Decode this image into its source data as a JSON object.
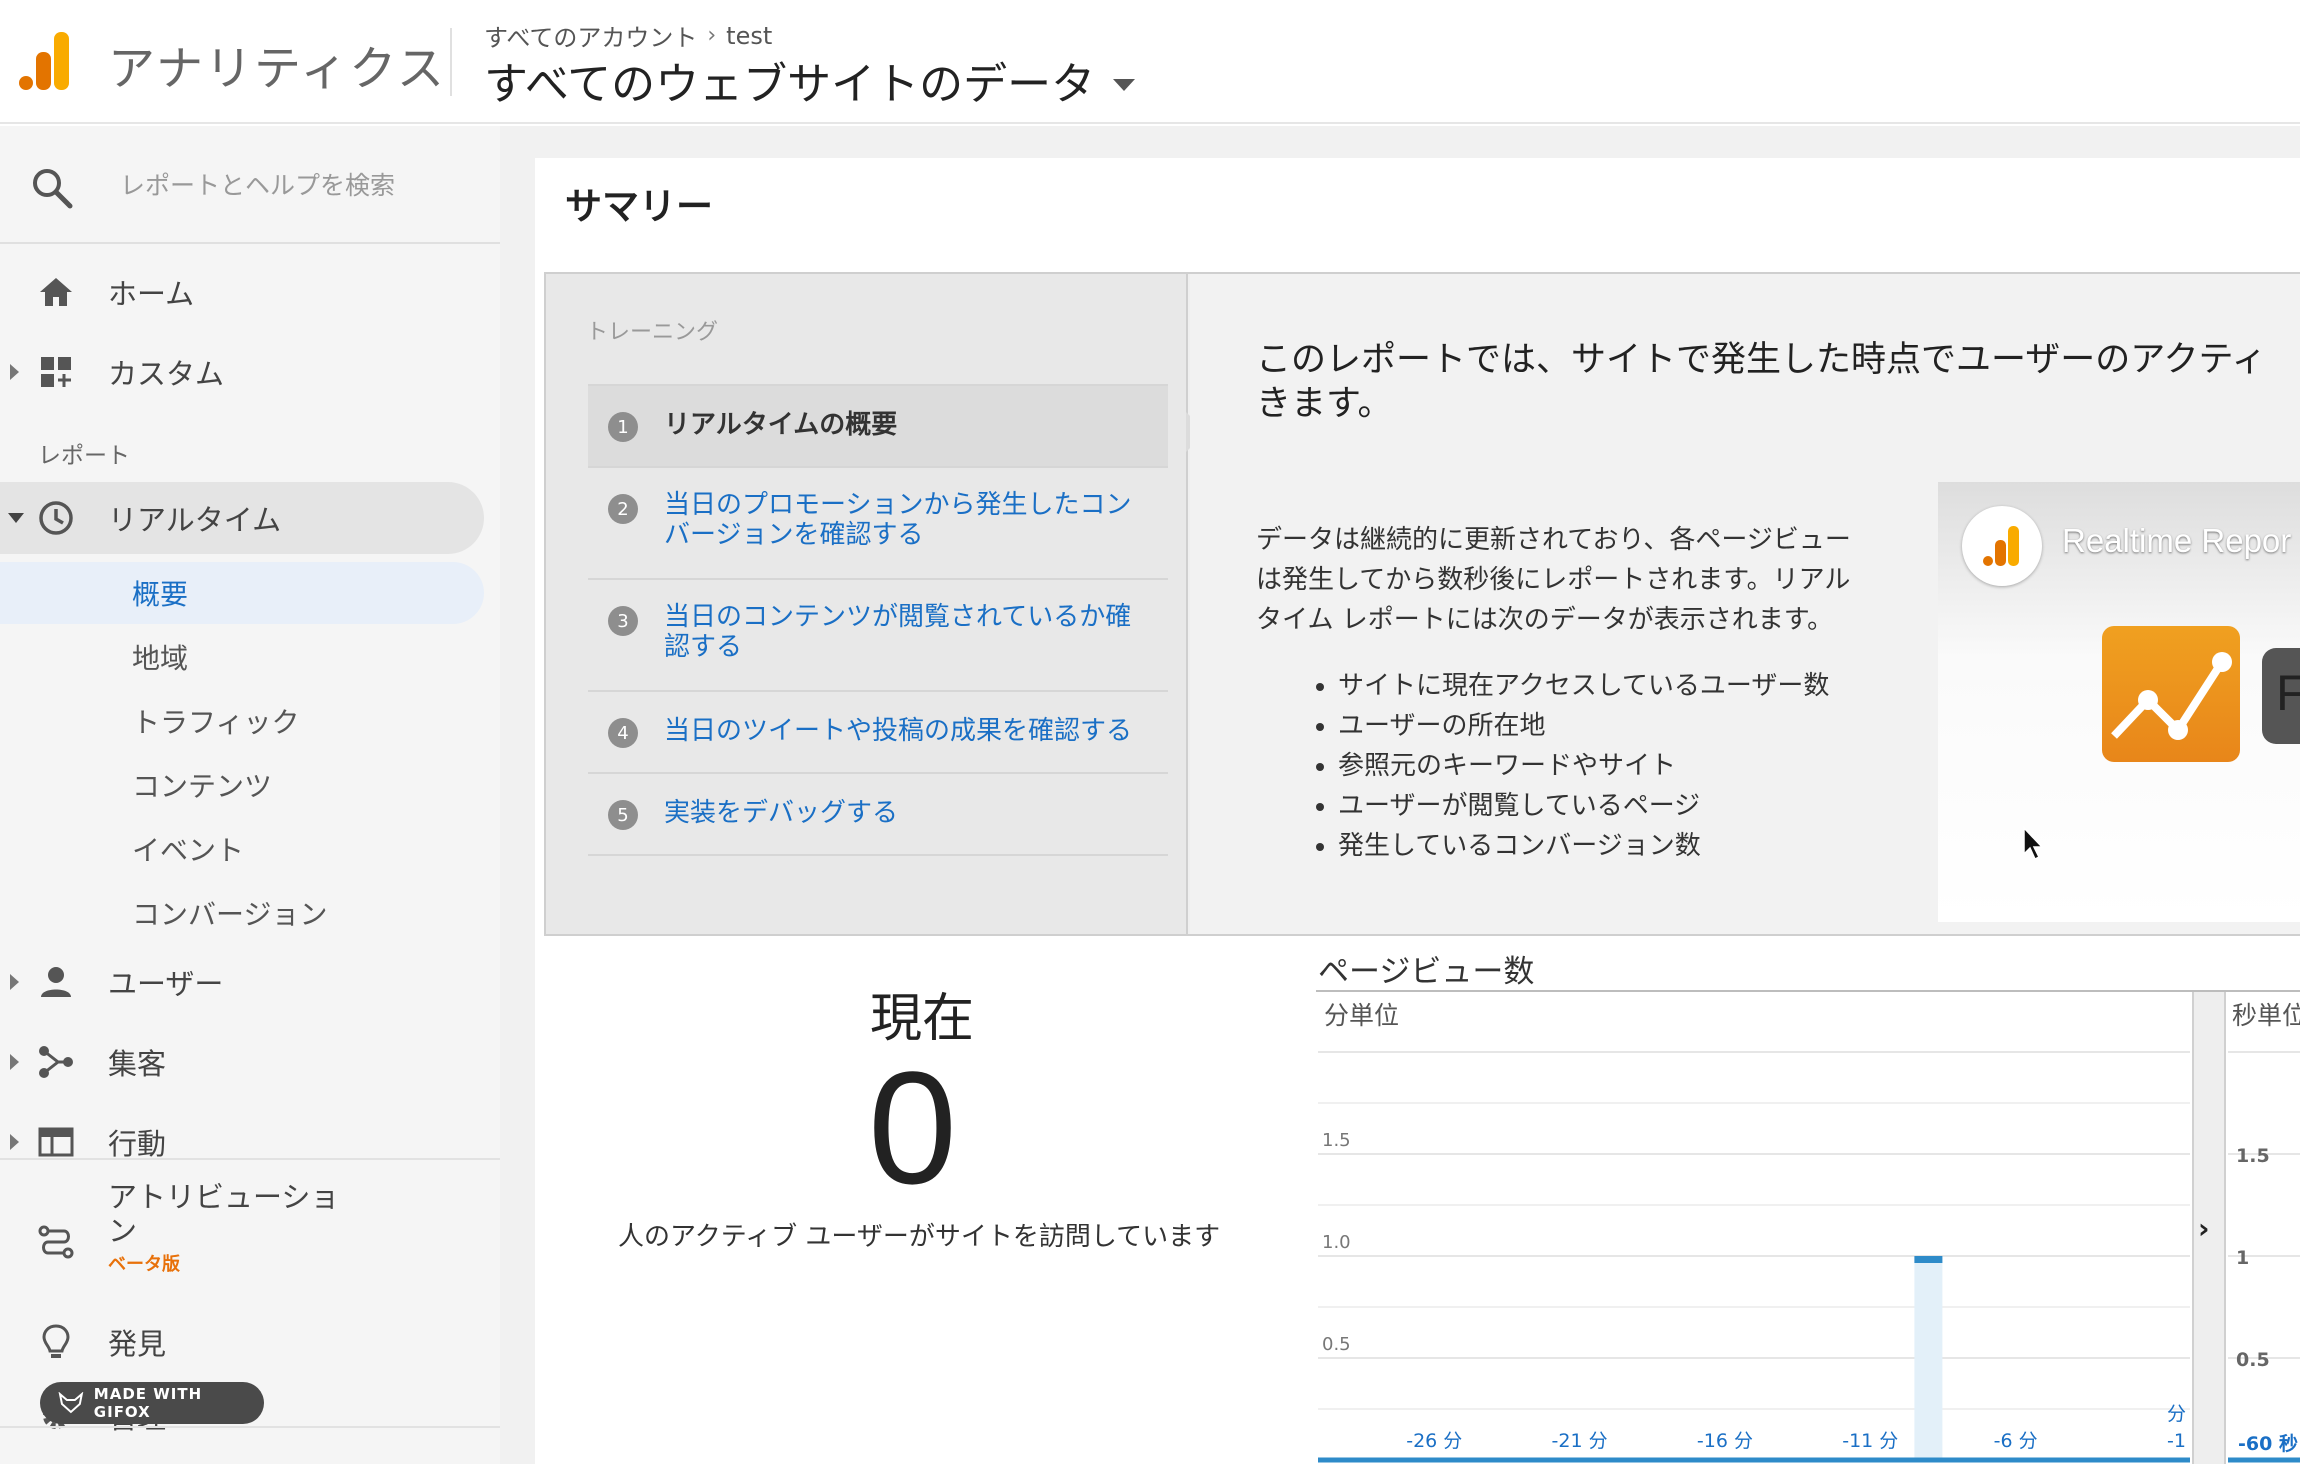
{
  "header": {
    "app_title": "アナリティクス",
    "breadcrumb": {
      "account": "すべてのアカウント",
      "property": "test"
    },
    "view_title": "すべてのウェブサイトのデータ"
  },
  "colors": {
    "accent_blue": "#1a6fc5",
    "logo_orange_light": "#f9ab00",
    "logo_orange_dark": "#e37400",
    "beta_orange": "#e8710a"
  },
  "sidebar": {
    "search_placeholder": "レポートとヘルプを検索",
    "home": "ホーム",
    "custom": "カスタム",
    "reports_label": "レポート",
    "realtime": "リアルタイム",
    "realtime_items": [
      "概要",
      "地域",
      "トラフィック",
      "コンテンツ",
      "イベント",
      "コンバージョン"
    ],
    "users": "ユーザー",
    "acquisition": "集客",
    "behavior": "行動",
    "attribution": "アトリビューション",
    "attribution_beta": "ベータ版",
    "discover": "発見",
    "admin": "管理",
    "gifox_badge": "MADE WITH GIFOX"
  },
  "main": {
    "page_title": "サマリー",
    "training": {
      "heading": "トレーニング",
      "steps": [
        {
          "num": "1",
          "text": "リアルタイムの概要"
        },
        {
          "num": "2",
          "text": "当日のプロモーションから発生したコンバージョンを確認する"
        },
        {
          "num": "3",
          "text": "当日のコンテンツが閲覧されているか確認する"
        },
        {
          "num": "4",
          "text": "当日のツイートや投稿の成果を確認する"
        },
        {
          "num": "5",
          "text": "実装をデバッグする"
        }
      ],
      "lead": "このレポートでは、サイトで発生した時点でユーザーのアクティ きます。",
      "description": "データは継続的に更新されており、各ページビューは発生してから数秒後にレポートされます。リアルタイム レポートには次のデータが表示されます。",
      "bullets": [
        "サイトに現在アクセスしているユーザー数",
        "ユーザーの所在地",
        "参照元のキーワードやサイト",
        "ユーザーが閲覧しているページ",
        "発生しているコンバージョン数"
      ],
      "video_title": "Realtime Repor",
      "video_letter": "F"
    },
    "current": {
      "label": "現在",
      "value": "0",
      "caption": "人のアクティブ ユーザーがサイトを訪問しています"
    }
  },
  "chart_data": {
    "type": "bar",
    "title": "ページビュー数",
    "panels": [
      {
        "label": "分単位",
        "x_ticks": [
          "-26 分",
          "-21 分",
          "-16 分",
          "-11 分",
          "-6 分",
          "-1"
        ],
        "x_unit_label": "分",
        "y_ticks": [
          "0.5",
          "1.0",
          "1.5"
        ],
        "ylim": [
          0,
          2
        ],
        "bars": [
          {
            "x": -9,
            "value": 1
          }
        ]
      },
      {
        "label": "秒単位",
        "x_ticks": [
          "-60 秒"
        ],
        "y_ticks": [
          "0.5",
          "1",
          "1.5"
        ],
        "ylim": [
          0,
          2
        ]
      }
    ]
  }
}
